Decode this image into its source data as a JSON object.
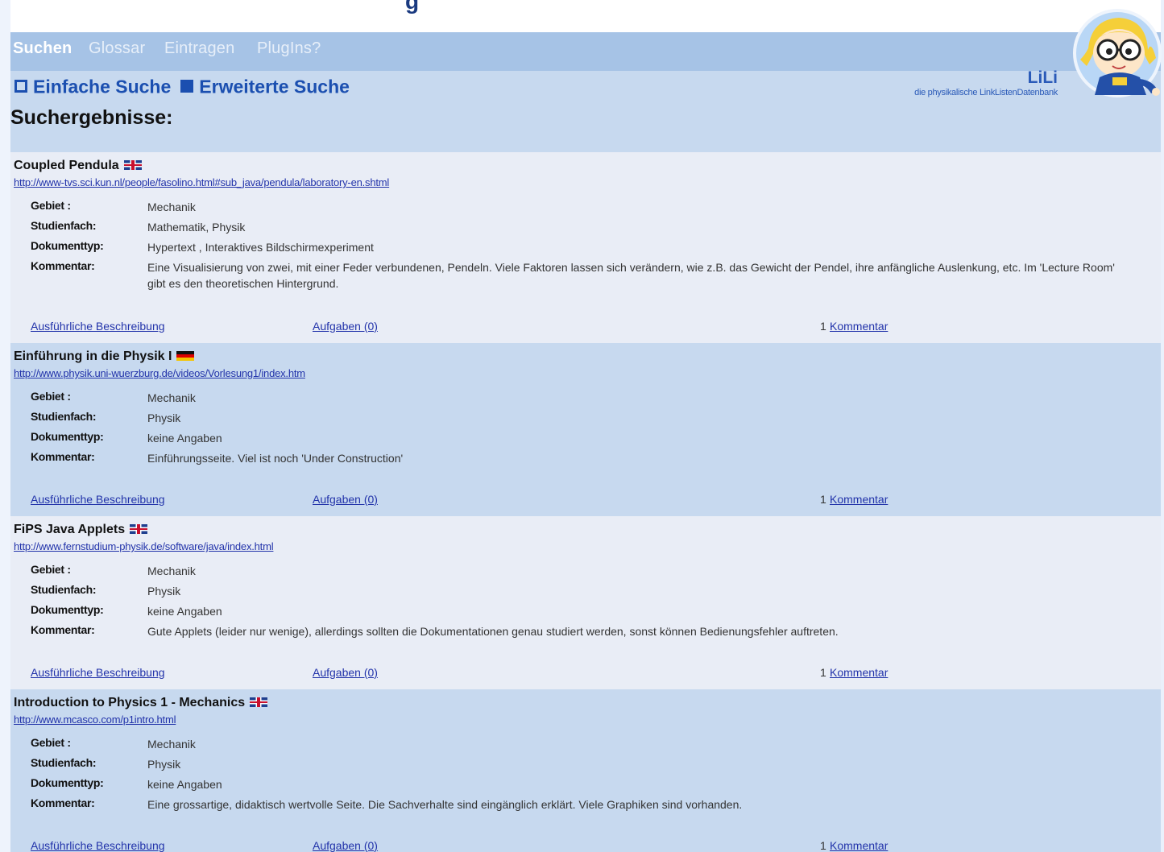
{
  "nav": {
    "items": [
      "Suchen",
      "Glossar",
      "Eintragen",
      "PlugIns?"
    ],
    "active": "Suchen"
  },
  "logo": {
    "title": "LiLi",
    "subtitle": "die physikalische LinkListenDatenbank"
  },
  "search_links": {
    "simple": "Einfache Suche",
    "advanced": "Erweiterte Suche"
  },
  "results_title": "Suchergebnisse:",
  "labels": {
    "gebiet": "Gebiet :",
    "studienfach": "Studienfach:",
    "dokumenttyp": "Dokumenttyp:",
    "kommentar": "Kommentar:"
  },
  "results": [
    {
      "title": "Coupled Pendula",
      "flag": "uk",
      "url": "http://www-tvs.sci.kun.nl/people/fasolino.html#sub_java/pendula/laboratory-en.shtml",
      "gebiet": "Mechanik",
      "studienfach": "Mathematik, Physik",
      "dokumenttyp": "Hypertext , Interaktives Bildschirmexperiment",
      "kommentar": "Eine Visualisierung von zwei, mit einer Feder verbundenen, Pendeln. Viele Faktoren lassen sich verändern, wie z.B. das Gewicht der Pendel, ihre anfängliche Auslenkung, etc. Im 'Lecture Room' gibt es den theoretischen Hintergrund.",
      "detail_link": "Ausführliche Beschreibung",
      "tasks_link": "Aufgaben (0)",
      "comment_count": "1",
      "comment_link": "Kommentar"
    },
    {
      "title": "Einführung in die Physik I",
      "flag": "de",
      "url": "http://www.physik.uni-wuerzburg.de/videos/Vorlesung1/index.htm",
      "gebiet": "Mechanik",
      "studienfach": "Physik",
      "dokumenttyp": "keine Angaben",
      "kommentar": "Einführungsseite. Viel ist noch 'Under Construction'",
      "detail_link": "Ausführliche Beschreibung",
      "tasks_link": "Aufgaben (0)",
      "comment_count": "1",
      "comment_link": "Kommentar"
    },
    {
      "title": "FiPS Java Applets",
      "flag": "uk",
      "url": "http://www.fernstudium-physik.de/software/java/index.html",
      "gebiet": "Mechanik",
      "studienfach": "Physik",
      "dokumenttyp": "keine Angaben",
      "kommentar": "Gute Applets (leider nur wenige), allerdings sollten die Dokumentationen genau studiert werden, sonst können Bedienungsfehler auftreten.",
      "detail_link": "Ausführliche Beschreibung",
      "tasks_link": "Aufgaben (0)",
      "comment_count": "1",
      "comment_link": "Kommentar"
    },
    {
      "title": "Introduction to Physics 1 - Mechanics",
      "flag": "uk",
      "url": "http://www.mcasco.com/p1intro.html",
      "gebiet": "Mechanik",
      "studienfach": "Physik",
      "dokumenttyp": "keine Angaben",
      "kommentar": "Eine grossartige, didaktisch wertvolle Seite. Die Sachverhalte sind eingänglich erklärt. Viele Graphiken sind vorhanden.",
      "detail_link": "Ausführliche Beschreibung",
      "tasks_link": "Aufgaben (0)",
      "comment_count": "1",
      "comment_link": "Kommentar"
    }
  ]
}
